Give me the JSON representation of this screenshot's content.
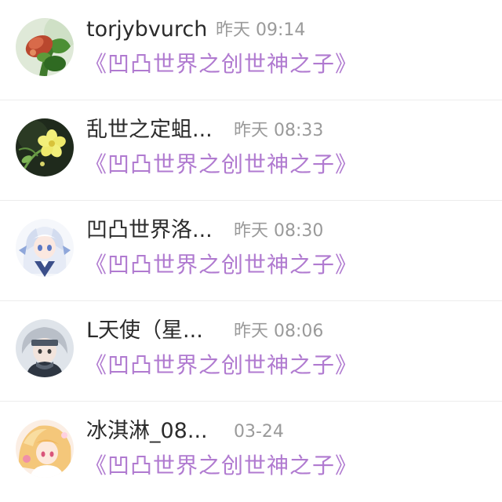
{
  "conversations": [
    {
      "name": "torjybvurch",
      "time": "昨天 09:14",
      "message": "《凹凸世界之创世神之子》",
      "avatar_icon": "red-flower-bud-avatar-icon"
    },
    {
      "name": "乱世之定蛆...",
      "time": "昨天 08:33",
      "message": "《凹凸世界之创世神之子》",
      "avatar_icon": "yellow-flower-avatar-icon"
    },
    {
      "name": "凹凸世界洛...",
      "time": "昨天 08:30",
      "message": "《凹凸世界之创世神之子》",
      "avatar_icon": "anime-girl-white-hair-avatar-icon"
    },
    {
      "name": "L天使（星...",
      "time": "昨天 08:06",
      "message": "《凹凸世界之创世神之子》",
      "avatar_icon": "anime-boy-grey-hair-avatar-icon"
    },
    {
      "name": "冰淇淋_08...",
      "time": "03-24",
      "message": "《凹凸世界之创世神之子》",
      "avatar_icon": "anime-blonde-avatar-icon"
    }
  ]
}
